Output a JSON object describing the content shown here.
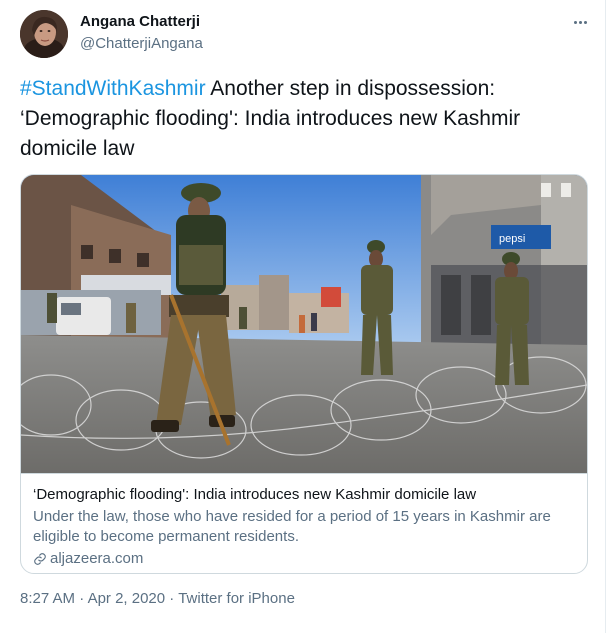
{
  "tweet": {
    "author": {
      "display_name": "Angana Chatterji",
      "handle": "@ChatterjiAngana"
    },
    "text": {
      "hashtag": "#StandWithKashmir",
      "body": " Another step in dispossession: ‘Demographic flooding': India introduces new Kashmir domicile law"
    },
    "card": {
      "title": "‘Demographic flooding': India introduces new Kashmir domicile law",
      "description": "Under the law, those who have resided for a period of 15 years in Kashmir are eligible to become permanent residents.",
      "domain": "aljazeera.com",
      "image_signs": {
        "pepsi_sign": "pepsi"
      }
    },
    "meta": {
      "time": "8:27 AM",
      "separator1": " · ",
      "date": "Apr 2, 2020",
      "separator2": " · ",
      "source": "Twitter for iPhone"
    }
  },
  "colors": {
    "link_blue": "#1b95e0",
    "secondary_text": "#5b7083",
    "border": "#cfd9de"
  },
  "icons": [
    "more-icon",
    "link-icon",
    "avatar"
  ]
}
